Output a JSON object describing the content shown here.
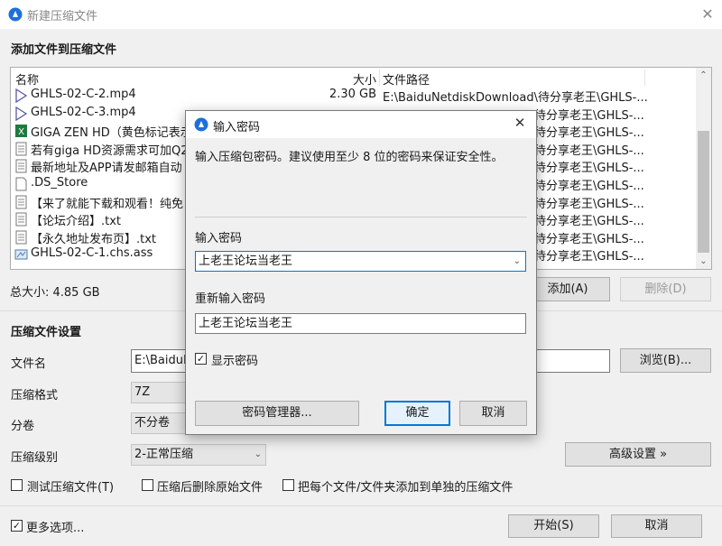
{
  "window": {
    "title": "新建压缩文件",
    "close_glyph": "✕"
  },
  "add_section": {
    "title": "添加文件到压缩文件"
  },
  "file_list": {
    "columns": {
      "name": "名称",
      "size": "大小",
      "path": "文件路径"
    },
    "rows": [
      {
        "icon": "video-file-icon",
        "name": "GHLS-02-C-2.mp4",
        "size": "2.30 GB",
        "path": "E:\\BaiduNetdiskDownload\\待分享老王\\GHLS-..."
      },
      {
        "icon": "video-file-icon",
        "name": "GHLS-02-C-3.mp4",
        "size": "",
        "path": "待分享老王\\GHLS-..."
      },
      {
        "icon": "excel-file-icon",
        "name": "GIGA ZEN HD（黄色标记表示",
        "size": "",
        "path": "待分享老王\\GHLS-..."
      },
      {
        "icon": "text-file-icon",
        "name": "若有giga HD资源需求可加Q2",
        "size": "",
        "path": "待分享老王\\GHLS-..."
      },
      {
        "icon": "text-file-icon",
        "name": "最新地址及APP请发邮箱自动",
        "size": "",
        "path": "待分享老王\\GHLS-..."
      },
      {
        "icon": "blank-file-icon",
        "name": ".DS_Store",
        "size": "",
        "path": "待分享老王\\GHLS-..."
      },
      {
        "icon": "text-file-icon",
        "name": "【来了就能下载和观看！纯免",
        "size": "",
        "path": "待分享老王\\GHLS-..."
      },
      {
        "icon": "text-file-icon",
        "name": "【论坛介绍】.txt",
        "size": "",
        "path": "待分享老王\\GHLS-..."
      },
      {
        "icon": "text-file-icon",
        "name": "【永久地址发布页】.txt",
        "size": "",
        "path": "待分享老王\\GHLS-..."
      },
      {
        "icon": "subtitle-file-icon",
        "name": "GHLS-02-C-1.chs.ass",
        "size": "",
        "path": "待分享老王\\GHLS-..."
      }
    ]
  },
  "total": {
    "label": "总大小: 4.85 GB"
  },
  "buttons": {
    "add": "添加(A)",
    "delete": "删除(D)",
    "browse": "浏览(B)...",
    "advanced": "高级设置 »",
    "start": "开始(S)",
    "cancel": "取消"
  },
  "settings": {
    "title": "压缩文件设置",
    "filename_label": "文件名",
    "filename_value": "E:\\BaiduN",
    "format_label": "压缩格式",
    "format_value": "7Z",
    "volume_label": "分卷",
    "volume_value": "不分卷",
    "level_label": "压缩级别",
    "level_value": "2-正常压缩"
  },
  "options": {
    "test": "测试压缩文件(T)",
    "delete_source": "压缩后删除原始文件",
    "separate": "把每个文件/文件夹添加到单独的压缩文件",
    "more": "更多选项..."
  },
  "dialog": {
    "title": "输入密码",
    "close_glyph": "✕",
    "hint": "输入压缩包密码。建议使用至少 8 位的密码来保证安全性。",
    "password_label": "输入密码",
    "password_value": "上老王论坛当老王",
    "confirm_label": "重新输入密码",
    "confirm_value": "上老王论坛当老王",
    "show_password": "显示密码",
    "manager_button": "密码管理器...",
    "ok_button": "确定",
    "cancel_button": "取消"
  },
  "colors": {
    "accent": "#0078d7",
    "window_bg": "#f0f0f0"
  }
}
